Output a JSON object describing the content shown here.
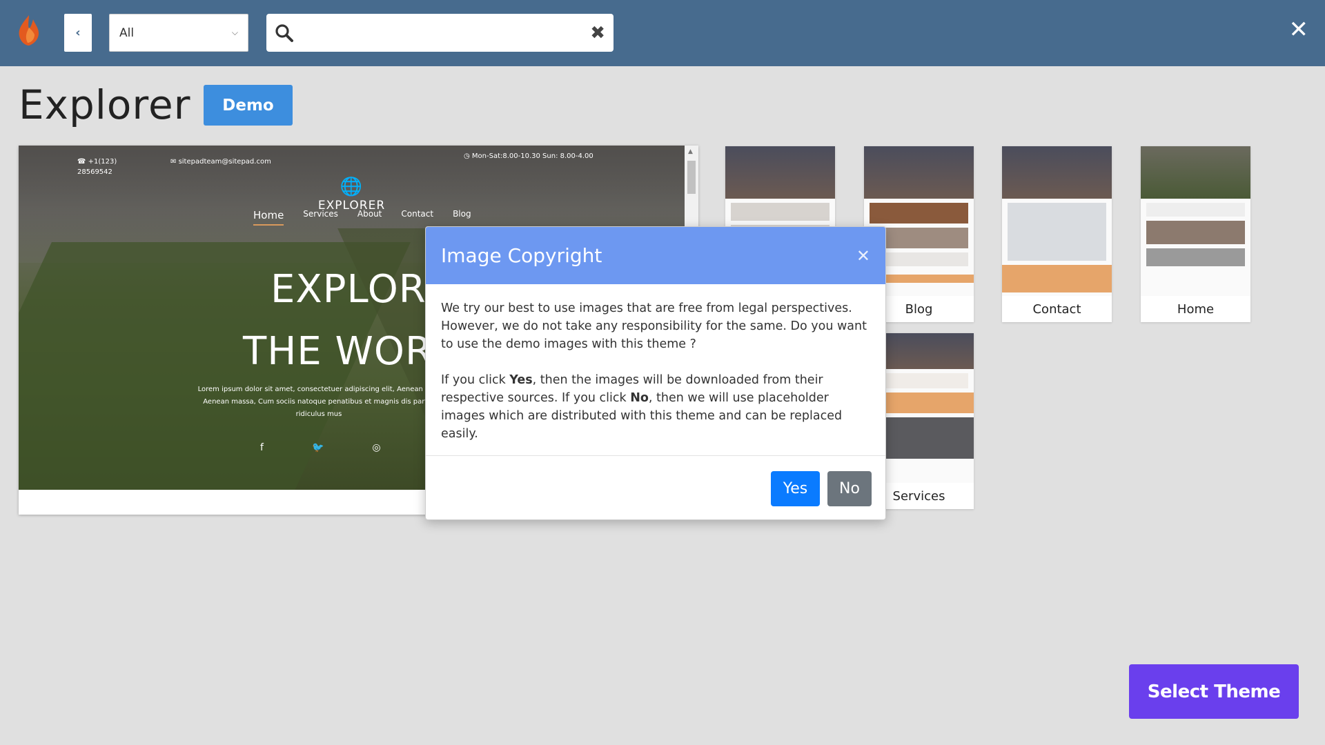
{
  "app": {
    "logo_icon": "flame-logo-icon"
  },
  "toolbar": {
    "back_label": "‹",
    "category_value": "All",
    "search_placeholder": "",
    "search_value": ""
  },
  "page": {
    "title": "Explorer",
    "demo_label": "Demo"
  },
  "preview": {
    "phone": "+1(123)\n28569542",
    "email": "sitepadteam@sitepad.com",
    "hours": "Mon-Sat:8.00-10.30 Sun: 8.00-4.00",
    "brand": "EXPLORER",
    "nav": [
      "Home",
      "Services",
      "About",
      "Contact",
      "Blog"
    ],
    "headline1": "EXPLORE",
    "headline2": "THE WORL",
    "lorem": "Lorem ipsum dolor sit amet, consectetuer adipiscing elit, Aenean com Aenean massa, Cum sociis natoque penatibus et magnis dis partur ridiculus mus"
  },
  "thumbnails": [
    {
      "label": ""
    },
    {
      "label": "Blog"
    },
    {
      "label": "Contact"
    },
    {
      "label": "Home"
    },
    {
      "label": "Services"
    }
  ],
  "modal": {
    "title": "Image Copyright",
    "paragraph1": "We try our best to use images that are free from legal perspectives. However, we do not take any responsibility for the same. Do you want to use the demo images with this theme ?",
    "p2_prefix": "If you click ",
    "p2_yes": "Yes",
    "p2_mid": ", then the images will be downloaded from their respective sources. If you click ",
    "p2_no": "No",
    "p2_suffix": ", then we will use placeholder images which are distributed with this theme and can be replaced easily.",
    "yes_label": "Yes",
    "no_label": "No"
  },
  "footer": {
    "select_theme_label": "Select Theme"
  },
  "colors": {
    "topbar": "#476b8e",
    "accent": "#3d8ede",
    "modal_header": "#6d98f1",
    "select_theme": "#6a3fed",
    "yes_btn": "#0a7bff",
    "no_btn": "#6c757d"
  }
}
